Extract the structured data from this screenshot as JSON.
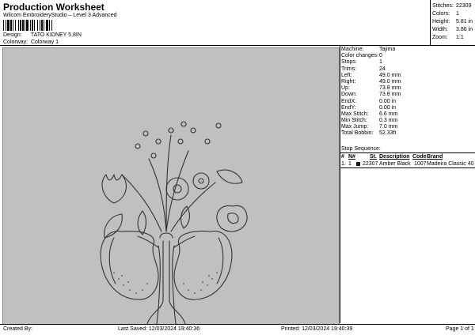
{
  "header": {
    "title": "Production Worksheet",
    "subtitle": "Wilcom EmbroideryStudio – Level 3 Advanced"
  },
  "design_info": {
    "design_label": "Design:",
    "design_value": "TATO KIDNEY 5,8IN",
    "colorway_label": "Colorway:",
    "colorway_value": "Colorway 1"
  },
  "top_stats": [
    {
      "label": "Stitches:",
      "value": "22309"
    },
    {
      "label": "Colors:",
      "value": "1"
    },
    {
      "label": "Height:",
      "value": "5.81 in"
    },
    {
      "label": "Width:",
      "value": "3.86 in"
    },
    {
      "label": "Zoom:",
      "value": "1:1"
    }
  ],
  "specs": [
    {
      "label": "Machine:",
      "value": "Tajima"
    },
    {
      "label": "Color changes:",
      "value": "0"
    },
    {
      "label": "Stops:",
      "value": "1"
    },
    {
      "label": "Trims:",
      "value": "24"
    },
    {
      "label": "Left:",
      "value": "49.0 mm"
    },
    {
      "label": "Right:",
      "value": "49.0 mm"
    },
    {
      "label": "Up:",
      "value": "73.8 mm"
    },
    {
      "label": "Down:",
      "value": "73.8 mm"
    },
    {
      "label": "EndX:",
      "value": "0.00 in"
    },
    {
      "label": "EndY:",
      "value": "0.00 in"
    },
    {
      "label": "Max Stitch:",
      "value": "6.6 mm"
    },
    {
      "label": "Min Stitch:",
      "value": "0.3 mm"
    },
    {
      "label": "Max Jump:",
      "value": "7.0 mm"
    },
    {
      "label": "Total Bobbin:",
      "value": "52.33ft"
    }
  ],
  "stop_sequence": {
    "title": "Stop Sequence:",
    "columns": [
      "#",
      "N#",
      "St.",
      "Description",
      "Code",
      "Brand"
    ],
    "rows": [
      {
        "num": "1.",
        "n": "1",
        "stitches": "22307",
        "description": "Amber Black",
        "code": "1007",
        "brand": "Madeira Classic 40",
        "color": "#1a1a1a"
      }
    ]
  },
  "footer": {
    "created_by": "Created By:",
    "last_saved": "Last Saved: 12/03/2024 19:40:36",
    "printed": "Printed: 12/03/2024 19:40:39",
    "page": "Page 1 of 1"
  },
  "colors": {
    "design_bg": "#c0c0c0",
    "stitch": "#333333"
  }
}
